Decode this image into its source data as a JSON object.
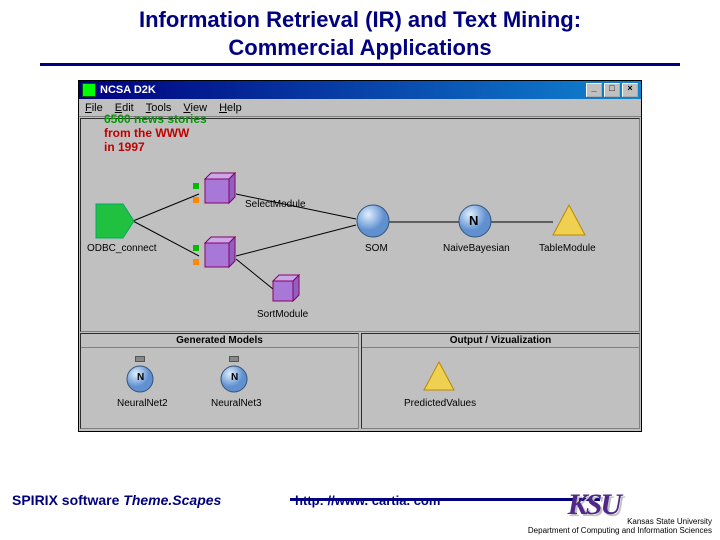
{
  "title": {
    "line1": "Information Retrieval (IR) and Text Mining:",
    "line2": "Commercial Applications"
  },
  "window": {
    "title": "NCSA D2K",
    "menus": {
      "file": "File",
      "edit": "Edit",
      "tools": "Tools",
      "view": "View",
      "help": "Help"
    },
    "overlay": {
      "line1": "6500 news stories",
      "line2": "from the WWW",
      "line3": "in 1997"
    },
    "nodes": {
      "odbc": "ODBC_connect",
      "select": "SelectModule",
      "som": "SOM",
      "naive": "NaiveBayesian",
      "n_label": "N",
      "table": "TableModule",
      "sort": "SortModule"
    },
    "panels": {
      "left": {
        "header": "Generated Models",
        "items": {
          "nn2": "NeuralNet2",
          "nn3": "NeuralNet3",
          "n_label": "N"
        }
      },
      "right": {
        "header": "Output / Vizualization",
        "items": {
          "pred": "PredictedValues"
        }
      }
    }
  },
  "footer": {
    "spirix_prefix": "SPIRIX software ",
    "spirix_italic": "Theme.Scapes",
    "url": "http: //www. cartia. com",
    "logo": "KSU",
    "affil_line1": "Kansas State University",
    "affil_line2": "Department of Computing and Information Sciences"
  }
}
